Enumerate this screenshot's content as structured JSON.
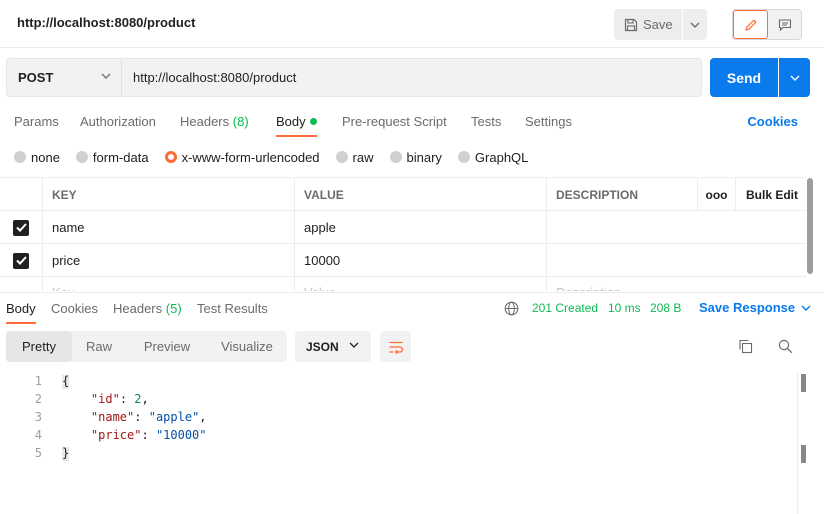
{
  "title_bar": {
    "title": "http://localhost:8080/product",
    "save_label": "Save"
  },
  "request": {
    "method": "POST",
    "url": "http://localhost:8080/product",
    "send_label": "Send"
  },
  "request_tabs": {
    "params": "Params",
    "authorization": "Authorization",
    "headers": "Headers",
    "headers_count": "(8)",
    "body": "Body",
    "pre_request": "Pre-request Script",
    "tests": "Tests",
    "settings": "Settings",
    "cookies": "Cookies"
  },
  "body_types": {
    "none": "none",
    "form_data": "form-data",
    "urlencoded": "x-www-form-urlencoded",
    "raw": "raw",
    "binary": "binary",
    "graphql": "GraphQL",
    "selected": "x-www-form-urlencoded"
  },
  "params_table": {
    "headers": {
      "key": "KEY",
      "value": "VALUE",
      "description": "DESCRIPTION",
      "more": "ooo",
      "bulk_edit": "Bulk Edit"
    },
    "rows": [
      {
        "key": "name",
        "value": "apple",
        "description": "",
        "checked": true
      },
      {
        "key": "price",
        "value": "10000",
        "description": "",
        "checked": true
      }
    ],
    "placeholder": {
      "key": "Key",
      "value": "Value",
      "description": "Description"
    }
  },
  "response": {
    "tabs": {
      "body": "Body",
      "cookies": "Cookies",
      "headers": "Headers",
      "headers_count": "(5)",
      "test_results": "Test Results"
    },
    "status": "201 Created",
    "time": "10 ms",
    "size": "208 B",
    "save_response": "Save Response",
    "views": {
      "pretty": "Pretty",
      "raw": "Raw",
      "preview": "Preview",
      "visualize": "Visualize"
    },
    "format": "JSON",
    "code": {
      "line_numbers": [
        "1",
        "2",
        "3",
        "4",
        "5"
      ],
      "open_brace": "{",
      "close_brace": "}",
      "id_key": "\"id\"",
      "id_value": "2",
      "name_key": "\"name\"",
      "name_value": "\"apple\"",
      "price_key": "\"price\"",
      "price_value": "\"10000\""
    }
  },
  "colors": {
    "accent": "#ff6c37",
    "primary": "#097bed",
    "success": "#0cbb52"
  }
}
